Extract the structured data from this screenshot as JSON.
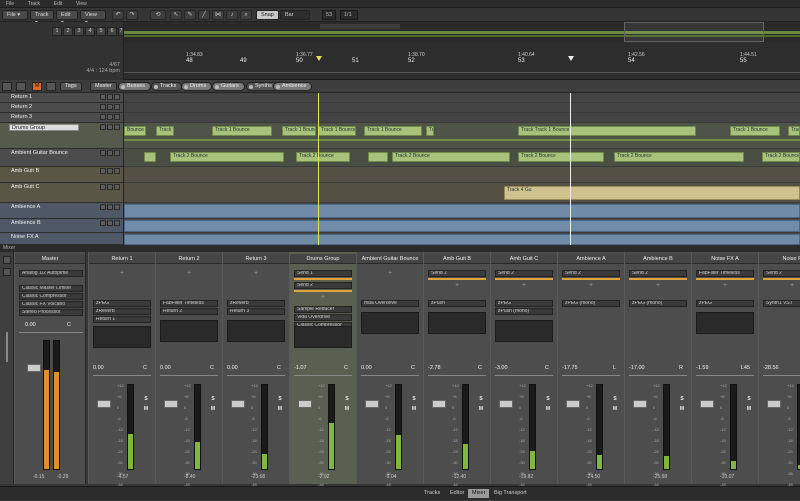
{
  "menu": [
    "File",
    "Track",
    "Edit",
    "View"
  ],
  "toolbar": {
    "snap": "Snap",
    "grid": "Bar",
    "position": "53",
    "subposition": "1/1"
  },
  "track_numbers": [
    "1",
    "2",
    "3",
    "4",
    "5",
    "6",
    "7"
  ],
  "timeinfo": {
    "bar": "4/67",
    "sig": "4/4 : 124 bpm"
  },
  "ruler": {
    "bars": [
      "48",
      "49",
      "50",
      "51",
      "52",
      "53",
      "54",
      "55"
    ],
    "times": [
      "1:34.83",
      "1:36.77",
      "1:38.70",
      "1:40.64",
      "1:42.56",
      "1:44.51"
    ],
    "labels": [
      "54",
      "51"
    ]
  },
  "tags": {
    "tags": "Tags",
    "master": "Master",
    "buses": "Busses",
    "tracks": "Tracks",
    "drums": "Drums",
    "guitars": "Guitars",
    "synths": "Synths",
    "ambience": "Ambience"
  },
  "tracks": [
    {
      "name": "Return 1"
    },
    {
      "name": "Return 2"
    },
    {
      "name": "Return 3"
    },
    {
      "name": "Drums Group",
      "selected": true
    },
    {
      "name": "Ambient Guitar Bounce"
    },
    {
      "name": "Amb Guit B"
    },
    {
      "name": "Amb Guit C"
    },
    {
      "name": "Ambience A"
    },
    {
      "name": "Ambience B"
    },
    {
      "name": "Noise FX A"
    }
  ],
  "clips": {
    "drums": [
      "Bounce",
      "Track 1 Bounce",
      "Track 1 Bounce",
      "Track 1 Bounce",
      "Track 1 Bounce",
      "Track 1 Bounce",
      "Track 1 Bounce",
      "Track Track 1 Bounce",
      "Track 1 Bounce",
      "Track 1 Bounce"
    ],
    "guitar": [
      "Track 2 Bounce",
      "Track 2 Bounce",
      "Track 2 Bounce",
      "Track 2 Bounce",
      "Track 2 Bounce",
      "Track 2 Bounce"
    ],
    "gtrc": [
      "Track 4 Gu"
    ]
  },
  "mixer": {
    "title": "Mixer",
    "master": {
      "name": "Master",
      "plugins": [
        "Analog 1/2 Autoplme",
        "Classic Master Limiter",
        "Classic Compressor",
        "Classic FX Volcano",
        "Stereo Processor"
      ],
      "vol": "0.00",
      "pan": "C",
      "peakL": "-0.15",
      "peakR": "-0.29"
    },
    "strips": [
      {
        "name": "Return 1",
        "plugins": [
          "zPEG",
          "zReverb",
          "Return 1"
        ],
        "vol": "0.00",
        "pan": "C",
        "peak": "-4.57",
        "level": 0.42
      },
      {
        "name": "Return 2",
        "plugins": [
          "FabFilter Timeless",
          "Return 2"
        ],
        "vol": "0.00",
        "pan": "C",
        "peak": "-8.40",
        "level": 0.32
      },
      {
        "name": "Return 3",
        "plugins": [
          "zReverb",
          "Return 3"
        ],
        "vol": "0.00",
        "pan": "C",
        "peak": "-23.68",
        "level": 0.18
      },
      {
        "name": "Drums Group",
        "sends": [
          "Send 1",
          "Send 2"
        ],
        "plugins": [
          "Sample Reducer",
          "Vida Overdrive",
          "Classic Compressor"
        ],
        "vol": "-1.07",
        "pan": "C",
        "peak": "-2.92",
        "level": 0.55,
        "selected": true
      },
      {
        "name": "Ambient Guitar Bounce",
        "plugins": [
          "mda Overdrive"
        ],
        "vol": "0.00",
        "pan": "C",
        "peak": "-9.04",
        "level": 0.4
      },
      {
        "name": "Amb Guit B",
        "sends": [
          "Send 2"
        ],
        "plugins": [
          "zPush"
        ],
        "vol": "-2.78",
        "pan": "C",
        "peak": "-12.40",
        "level": 0.3
      },
      {
        "name": "Amb Guit C",
        "sends": [
          "Send 2"
        ],
        "plugins": [
          "zPEG",
          "zPush (mono)"
        ],
        "vol": "-3.00",
        "pan": "C",
        "peak": "-19.82",
        "level": 0.22
      },
      {
        "name": "Ambience A",
        "sends": [
          "Send 2"
        ],
        "plugins": [
          "zPEG (mono)"
        ],
        "vol": "-17.75",
        "pan": "L",
        "peak": "-24.50",
        "level": 0.17
      },
      {
        "name": "Ambience B",
        "sends": [
          "Send 2"
        ],
        "plugins": [
          "zPEG (mono)"
        ],
        "vol": "-17.00",
        "pan": "R",
        "peak": "-25.68",
        "level": 0.15
      },
      {
        "name": "Noise FX A",
        "sends": [
          "FabFilter Timeless"
        ],
        "plugins": [
          "zPEG"
        ],
        "vol": "-1.59",
        "pan": "L45",
        "peak": "-10.07",
        "level": 0.1
      },
      {
        "name": "Noise F",
        "sends": [
          "Send 2"
        ],
        "plugins": [
          "Synth1 VST"
        ],
        "vol": "-28.56",
        "pan": "",
        "peak": "",
        "level": 0.05
      }
    ],
    "scale": [
      "+12",
      "+6",
      "0",
      "-6",
      "-12",
      "-18",
      "-24",
      "-30",
      "-36",
      "-48",
      "-60"
    ]
  },
  "bottom_tabs": [
    "Tracks",
    "Editor",
    "Mixer",
    "Big Transport"
  ]
}
